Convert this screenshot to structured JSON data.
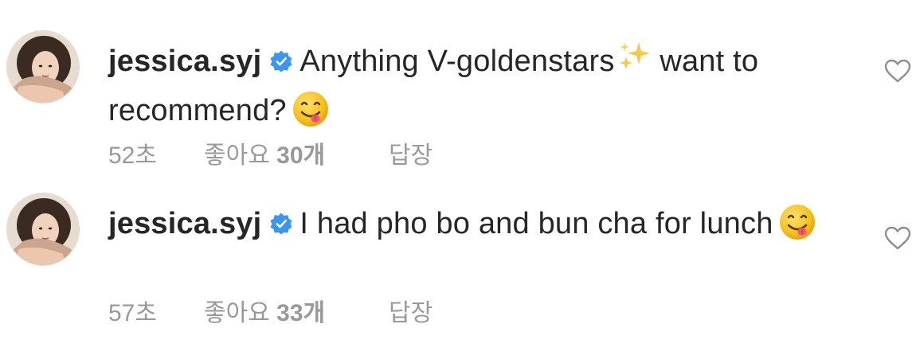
{
  "colors": {
    "text": "#262626",
    "meta": "#999999",
    "verified": "#3897f0",
    "heart_outline": "#8e8e8e"
  },
  "comments": [
    {
      "username": "jessica.syj",
      "text": "Anything V-goldenstars",
      "text_after_sparkles": " want to recommend?",
      "emoji": "face-savoring-food-emoji",
      "time": "52초",
      "likes_prefix": "좋아요 ",
      "likes_count": "30",
      "likes_suffix": "개",
      "reply": "답장"
    },
    {
      "username": "jessica.syj",
      "text": "I had pho bo and bun cha for lunch",
      "emoji": "face-savoring-food-emoji",
      "time": "57초",
      "likes_prefix": "좋아요 ",
      "likes_count": "33",
      "likes_suffix": "개",
      "reply": "답장"
    }
  ],
  "icons": {
    "verified": "verified-badge-icon",
    "like": "heart-outline-icon",
    "sparkles": "sparkles-emoji"
  }
}
